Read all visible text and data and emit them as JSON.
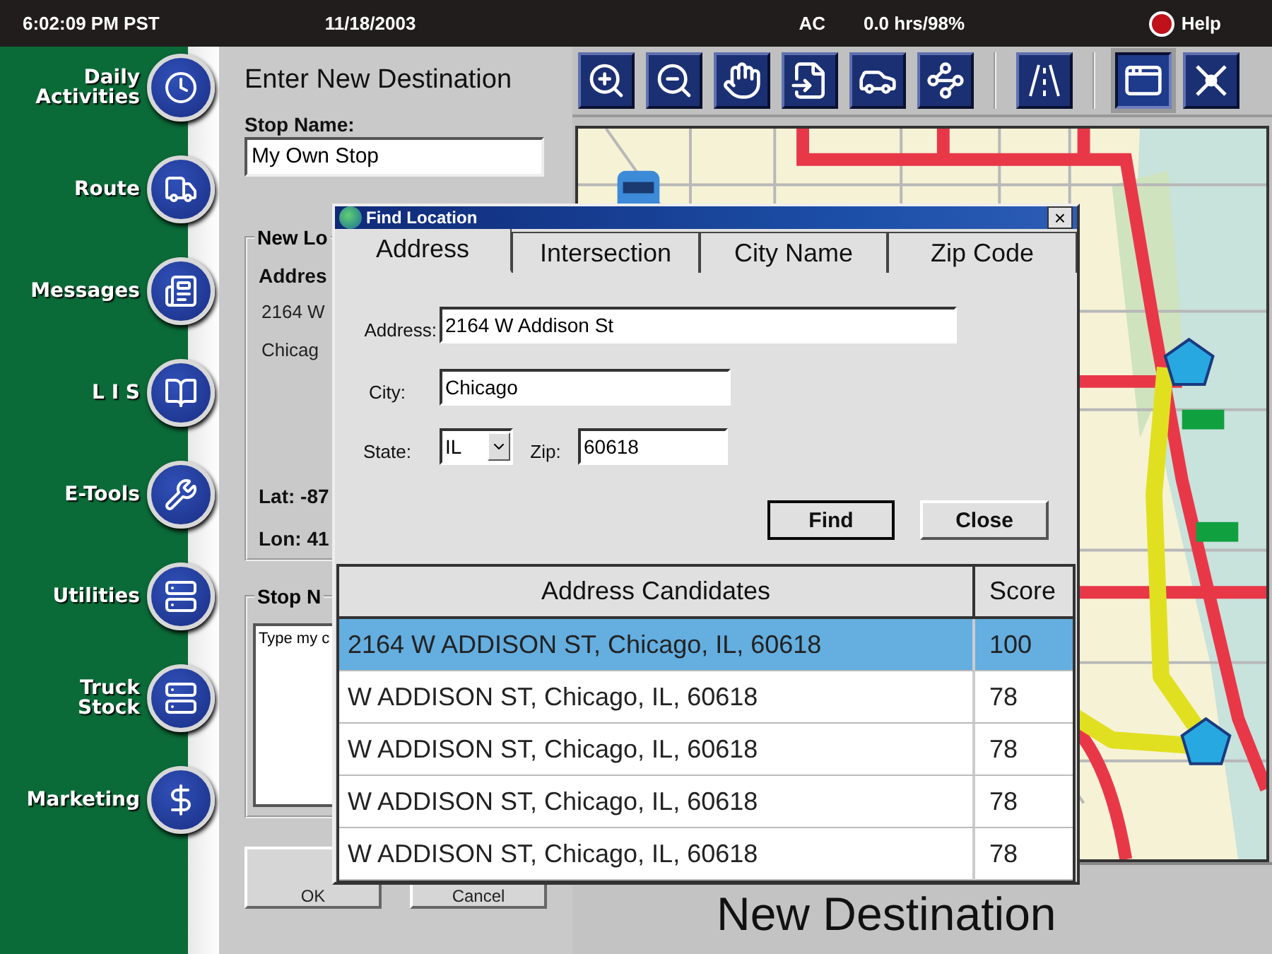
{
  "status_bar": {
    "time": "6:02:09 PM PST",
    "date": "11/18/2003",
    "power": "AC",
    "hours": "0.0 hrs/98%",
    "help": "Help"
  },
  "sidebar": {
    "items": [
      {
        "label": "Daily Activities"
      },
      {
        "label": "Route"
      },
      {
        "label": "Messages"
      },
      {
        "label": "L I S"
      },
      {
        "label": "E-Tools"
      },
      {
        "label": "Utilities"
      },
      {
        "label": "Truck Stock"
      },
      {
        "label": "Marketing"
      }
    ]
  },
  "form": {
    "title": "Enter New Destination",
    "stop_name_label": "Stop Name:",
    "stop_name_value": "My Own Stop",
    "location_group": {
      "legend": "New Lo",
      "address_label": "Addres",
      "address_line": "2164 W",
      "city_line": "Chicag",
      "lat": "Lat: -87",
      "lon": "Lon: 41"
    },
    "notes_group": {
      "legend": "Stop N",
      "value": "Type my c"
    },
    "buttons": [
      "OK",
      "Cancel"
    ]
  },
  "toolbar": {
    "buttons": [
      {
        "pressed": false
      },
      {
        "pressed": false
      },
      {
        "pressed": false
      },
      {
        "pressed": false
      },
      {
        "pressed": false
      },
      {
        "pressed": false
      },
      {
        "pressed": false
      },
      {
        "pressed": true
      },
      {
        "pressed": false
      }
    ]
  },
  "bottom_panel": {
    "title": "New Destination"
  },
  "dialog": {
    "title": "Find Location",
    "close": "×",
    "tabs": [
      {
        "label": "Address",
        "selected": true
      },
      {
        "label": "Intersection",
        "selected": false
      },
      {
        "label": "City Name",
        "selected": false
      },
      {
        "label": "Zip Code",
        "selected": false
      }
    ],
    "address_label": "Address:",
    "address_value": "2164 W Addison St",
    "city_label": "City:",
    "city_value": "Chicago",
    "state_label": "State:",
    "state_value": "IL",
    "zip_label": "Zip:",
    "zip_value": "60618",
    "buttons": [
      "Find",
      "Close"
    ],
    "table": {
      "columns": [
        "Address Candidates",
        "Score"
      ],
      "rows": [
        {
          "cells": [
            "2164 W ADDISON ST, Chicago, IL, 60618",
            "100"
          ],
          "selected": true
        },
        {
          "cells": [
            "W ADDISON ST, Chicago, IL, 60618",
            "78"
          ],
          "selected": false
        },
        {
          "cells": [
            "W ADDISON ST, Chicago, IL, 60618",
            "78"
          ],
          "selected": false
        },
        {
          "cells": [
            "W ADDISON ST, Chicago, IL, 60618",
            "78"
          ],
          "selected": false
        },
        {
          "cells": [
            "W ADDISON ST, Chicago, IL, 60618",
            "78"
          ],
          "selected": false
        }
      ]
    }
  }
}
